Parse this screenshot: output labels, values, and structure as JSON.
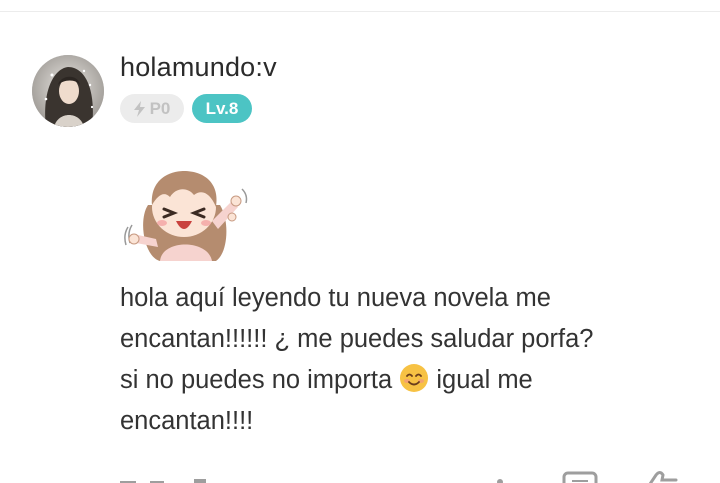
{
  "comment": {
    "author": {
      "username": "holamundo:v",
      "points_label": "P0",
      "level_label": "Lv.8"
    },
    "sticker_icon": "chibi-girl-cheering-sticker",
    "text_lines": [
      "hola aquí leyendo tu nueva novela me",
      "encantan!!!!!! ¿ me puedes saludar porfa?",
      "si no puedes no importa",
      "igual me",
      "encantan!!!!"
    ],
    "inline_emoji": "smiling-face-with-smiling-eyes-emoji"
  },
  "colors": {
    "level_badge": "#4cc4c4",
    "points_badge": "#ececec",
    "text": "#333333"
  },
  "icons": {
    "points": "bolt-icon",
    "footer": [
      "more-icon",
      "comment-icon",
      "like-icon"
    ]
  }
}
